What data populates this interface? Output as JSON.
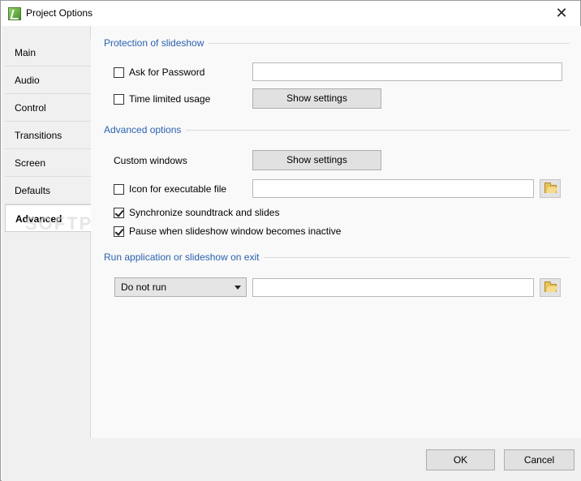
{
  "window": {
    "title": "Project Options"
  },
  "sidebar": {
    "items": [
      {
        "label": "Main"
      },
      {
        "label": "Audio"
      },
      {
        "label": "Control"
      },
      {
        "label": "Transitions"
      },
      {
        "label": "Screen"
      },
      {
        "label": "Defaults"
      },
      {
        "label": "Advanced",
        "active": true
      }
    ]
  },
  "protection": {
    "title": "Protection of slideshow",
    "ask_password": {
      "label": "Ask for Password",
      "checked": false,
      "value": ""
    },
    "time_limited": {
      "label": "Time limited usage",
      "checked": false,
      "button": "Show settings"
    }
  },
  "advanced": {
    "title": "Advanced options",
    "custom_windows": {
      "label": "Custom windows",
      "button": "Show settings"
    },
    "icon_file": {
      "label": "Icon for executable file",
      "checked": false,
      "value": ""
    },
    "sync_soundtrack": {
      "label": "Synchronize soundtrack and slides",
      "checked": true
    },
    "pause_inactive": {
      "label": "Pause when slideshow window becomes inactive",
      "checked": true
    }
  },
  "run_on_exit": {
    "title": "Run application or slideshow on exit",
    "select_value": "Do not run",
    "path_value": ""
  },
  "footer": {
    "ok": "OK",
    "cancel": "Cancel"
  },
  "watermark": "SOFTPEDIA",
  "icons": {
    "app": "slideshow-app-icon",
    "close": "close-icon",
    "folder": "folder-open-icon",
    "dropdown": "chevron-down-icon"
  },
  "colors": {
    "section_title": "#2a62b0",
    "sidebar_bg": "#f0f0f0",
    "content_bg": "#f9f9f9"
  }
}
